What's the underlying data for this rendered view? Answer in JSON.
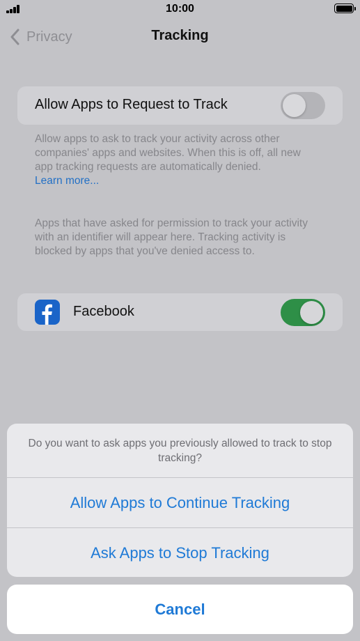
{
  "status_bar": {
    "time": "10:00"
  },
  "nav": {
    "back_label": "Privacy",
    "title": "Tracking"
  },
  "allow_tracking": {
    "label": "Allow Apps to Request to Track",
    "enabled": false,
    "footnote": "Allow apps to ask to track your activity across other companies' apps and websites. When this is off, all new app tracking requests are automatically denied.",
    "learn_more": "Learn more..."
  },
  "apps_footnote": "Apps that have asked for permission to track your activity with an identifier will appear here. Tracking activity is blocked by apps that you've denied access to.",
  "apps": [
    {
      "name": "Facebook",
      "icon": "facebook-icon",
      "enabled": true
    }
  ],
  "action_sheet": {
    "message": "Do you want to ask apps you previously allowed to track to stop tracking?",
    "options": [
      "Allow Apps to Continue Tracking",
      "Ask Apps to Stop Tracking"
    ],
    "cancel": "Cancel"
  },
  "colors": {
    "accent": "#1f7ad6",
    "toggle_on": "#2e8f47",
    "facebook": "#1a64c8"
  }
}
